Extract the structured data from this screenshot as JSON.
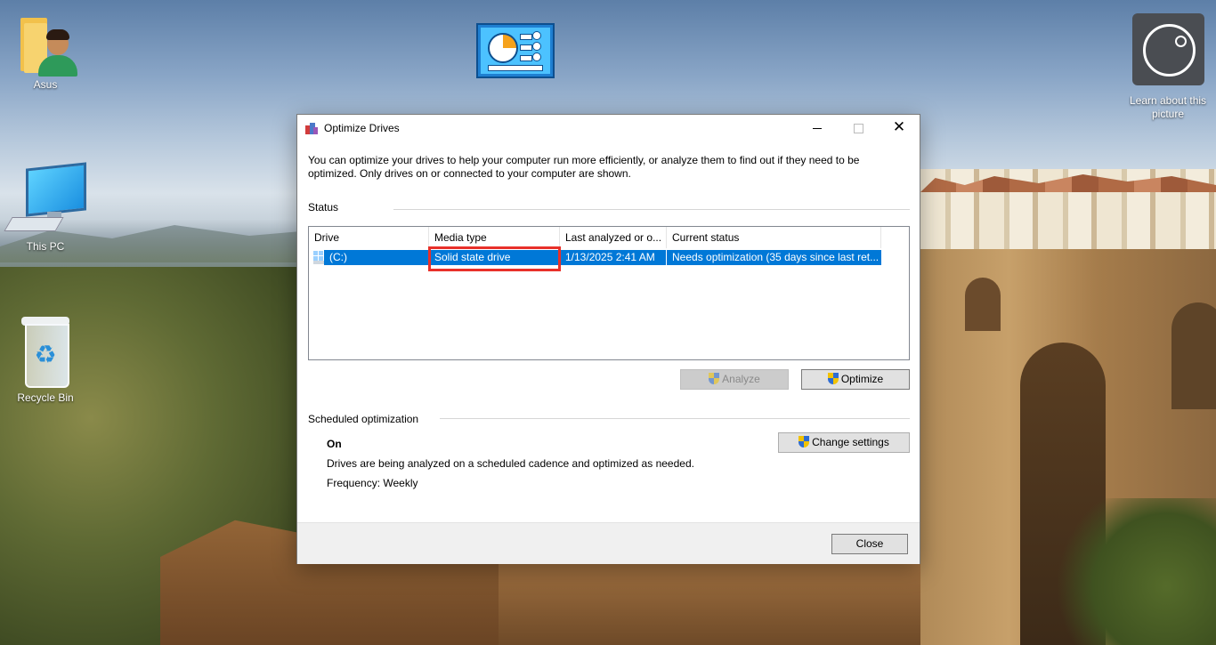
{
  "desktop": {
    "icons": [
      {
        "label": "Asus",
        "icon": "user-folder-icon"
      },
      {
        "label": "This PC",
        "icon": "computer-icon"
      },
      {
        "label": "Recycle Bin",
        "icon": "recycle-bin-icon"
      }
    ],
    "control_panel_icon": "control-panel-icon",
    "learn_picture": {
      "label": "Learn about this picture",
      "icon": "camera-icon"
    }
  },
  "window": {
    "title": "Optimize Drives",
    "title_icon": "defrag-icon",
    "controls": {
      "minimize": "minimize-icon",
      "maximize": "maximize-icon",
      "close": "✕"
    },
    "description": "You can optimize your drives to help your computer run more efficiently, or analyze them to find out if they need to be optimized. Only drives on or connected to your computer are shown.",
    "status_label": "Status",
    "columns": [
      "Drive",
      "Media type",
      "Last analyzed or o...",
      "Current status"
    ],
    "rows": [
      {
        "drive": "(C:)",
        "media_type": "Solid state drive",
        "last_analyzed": "1/13/2025 2:41 AM",
        "status": "Needs optimization (35 days since last ret..."
      }
    ],
    "selected_row": 0,
    "analyze_label": "Analyze",
    "optimize_label": "Optimize",
    "scheduled_label": "Scheduled optimization",
    "schedule_state": "On",
    "schedule_desc": "Drives are being analyzed on a scheduled cadence and optimized as needed.",
    "frequency": "Frequency: Weekly",
    "change_settings_label": "Change settings",
    "close_label": "Close"
  },
  "colors": {
    "selection": "#0078d7",
    "highlight_annotation": "#e8302a"
  }
}
